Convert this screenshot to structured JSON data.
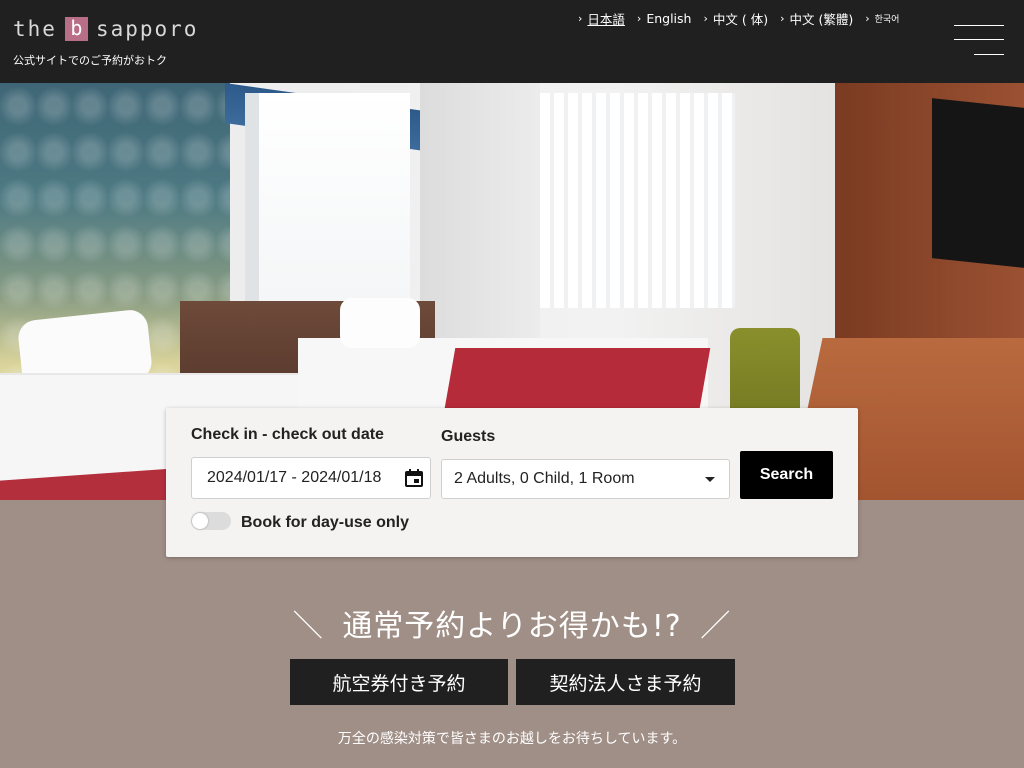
{
  "header": {
    "logo": {
      "prefix": "the",
      "mark": "b",
      "suffix": "sapporo"
    },
    "tagline": "公式サイトでのご予約がおトク",
    "languages": [
      {
        "label": "日本語",
        "active": true
      },
      {
        "label": "English",
        "active": false
      },
      {
        "label": "中文 (  体)",
        "active": false
      },
      {
        "label": "中文 (繁體)",
        "active": false
      },
      {
        "label": "한국어",
        "active": false
      }
    ],
    "menu_icon": "hamburger-menu-icon"
  },
  "hero": {
    "image": "hotel-twin-room-photo"
  },
  "search": {
    "dates_label": "Check in - check out date",
    "dates_value": "2024/01/17 - 2024/01/18",
    "guests_label": "Guests",
    "guests_value": "2 Adults, 0 Child, 1 Room",
    "search_button": "Search",
    "dayuse_label": "Book for day-use only",
    "dayuse_enabled": false
  },
  "promo": {
    "slash_left": "＼",
    "heading": "通常予約よりお得かも!?",
    "slash_right": "／",
    "buttons": [
      {
        "label": "航空券付き予約"
      },
      {
        "label": "契約法人さま予約"
      }
    ],
    "notice": "万全の感染対策で皆さまのお越しをお待ちしています。"
  },
  "colors": {
    "header_bg": "#202020",
    "logo_accent": "#b86e86",
    "page_bg": "#a08f87",
    "card_bg": "#f4f3f1",
    "button_dark": "#000000"
  }
}
